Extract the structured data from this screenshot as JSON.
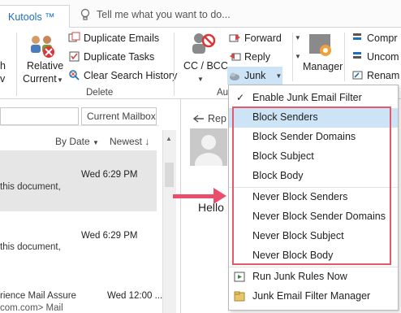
{
  "tabs": {
    "active": "Kutools ™",
    "tell_me": "Tell me what you want to do..."
  },
  "ribbon": {
    "left_partial": {
      "line1": "h",
      "line2": "v"
    },
    "relative_current": {
      "line1": "Relative",
      "line2": "Current"
    },
    "duplicate_emails": "Duplicate Emails",
    "duplicate_tasks": "Duplicate Tasks",
    "clear_search_history": "Clear Search History",
    "delete_group": "Delete",
    "cc_bcc": "CC / BCC",
    "forward": "Forward",
    "reply": "Reply",
    "junk": "Junk",
    "manager": "Manager",
    "comp": "Compr",
    "uncom": "Uncom",
    "renam": "Renam",
    "au_group": "Au"
  },
  "mail_list": {
    "mailbox_select": "Current Mailbox",
    "sort_by": "By Date",
    "sort_order": "Newest",
    "items": [
      {
        "date": "Wed 6:29 PM",
        "snippet": "this document,"
      },
      {
        "date": "Wed 6:29 PM",
        "snippet": "this document,"
      },
      {
        "subject": "rience Mail Assure",
        "date": "Wed 12:00 ...",
        "snippet": "com.com> Mail"
      }
    ]
  },
  "reading_pane": {
    "reply": "Rep",
    "greeting": "Hello"
  },
  "junk_menu": {
    "items": [
      "Enable Junk Email Filter",
      "Block Senders",
      "Block Sender Domains",
      "Block Subject",
      "Block Body",
      "Never Block Senders",
      "Never Block Sender Domains",
      "Never Block Subject",
      "Never Block Body",
      "Run Junk Rules Now",
      "Junk Email Filter Manager"
    ],
    "checked_item": "Enable Junk Email Filter",
    "highlighted_item": "Block Senders"
  },
  "colors": {
    "accent_blue": "#1d6fb8",
    "highlight": "#cde4f7",
    "annotation_red": "#e35a6c"
  }
}
